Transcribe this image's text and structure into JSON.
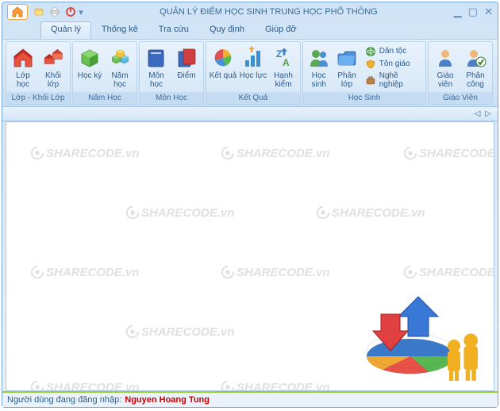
{
  "title": "QUẢN LÝ ĐIỂM HỌC SINH TRUNG HỌC PHỔ THÔNG",
  "tabs": [
    "Quản lý",
    "Thống kê",
    "Tra cứu",
    "Quy định",
    "Giúp đỡ"
  ],
  "activeTab": 0,
  "ribbon": {
    "groups": [
      {
        "label": "Lớp - Khối Lớp",
        "items": [
          {
            "label": "Lớp học",
            "icon": "house-red"
          },
          {
            "label": "Khối lớp",
            "icon": "houses"
          }
        ]
      },
      {
        "label": "Năm Học",
        "items": [
          {
            "label": "Học kỳ",
            "icon": "cube-green"
          },
          {
            "label": "Năm học",
            "icon": "cubes"
          }
        ]
      },
      {
        "label": "Môn Học",
        "items": [
          {
            "label": "Môn học",
            "icon": "book-blue"
          },
          {
            "label": "Điểm",
            "icon": "book-red"
          }
        ]
      },
      {
        "label": "Kết Quả",
        "items": [
          {
            "label": "Kết quả",
            "icon": "pie"
          },
          {
            "label": "Học lực",
            "icon": "bars-up"
          },
          {
            "label": "Hạnh kiểm",
            "icon": "az"
          }
        ]
      },
      {
        "label": "Học Sinh",
        "items": [
          {
            "label": "Học sinh",
            "icon": "people"
          },
          {
            "label": "Phân lớp",
            "icon": "folder-blue"
          }
        ],
        "smallItems": [
          {
            "label": "Dân tộc",
            "icon": "globe"
          },
          {
            "label": "Tôn giáo",
            "icon": "shield"
          },
          {
            "label": "Nghề nghiệp",
            "icon": "briefcase"
          }
        ]
      },
      {
        "label": "Giáo Viên",
        "items": [
          {
            "label": "Giáo viên",
            "icon": "person"
          },
          {
            "label": "Phân công",
            "icon": "person-check"
          }
        ]
      }
    ]
  },
  "watermark": "SHARECODE.vn",
  "status": {
    "label": "Người dùng đang đăng nhập:",
    "username": "Nguyen Hoang Tung"
  }
}
